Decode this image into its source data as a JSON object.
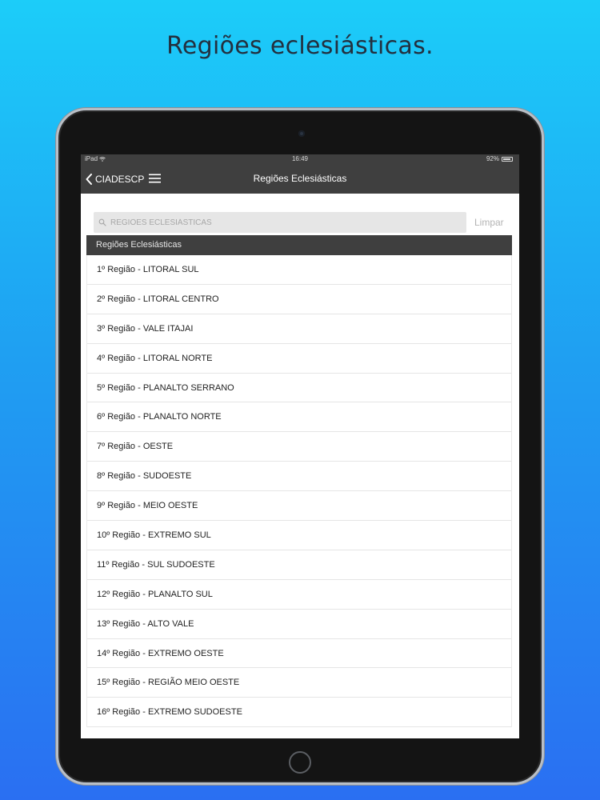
{
  "headline": "Regiões eclesiásticas.",
  "status_bar": {
    "carrier": "iPad",
    "time": "16:49",
    "battery": "92%",
    "battery_level": 0.92
  },
  "nav": {
    "back_label": "CIADESCP",
    "title": "Regiões Eclesiásticas"
  },
  "search": {
    "placeholder": "REGIÕES ECLESIÁSTICAS",
    "value": "",
    "clear_label": "Limpar"
  },
  "section_header": "Regiões Eclesiásticas",
  "regions": [
    "1º Região - LITORAL SUL",
    "2º Região - LITORAL CENTRO",
    "3º Região - VALE ITAJAI",
    "4º Região - LITORAL NORTE",
    "5º Região - PLANALTO SERRANO",
    "6º Região - PLANALTO NORTE",
    "7º Região - OESTE",
    "8º Região - SUDOESTE",
    "9º Região - MEIO OESTE",
    "10º Região - EXTREMO SUL",
    "11º Região - SUL SUDOESTE",
    "12º Região - PLANALTO SUL",
    "13º Região - ALTO VALE",
    "14º Região - EXTREMO OESTE",
    "15º Região - REGIÃO MEIO OESTE",
    "16º Região - EXTREMO SUDOESTE"
  ],
  "colors": {
    "bar_background": "#3f3f3f",
    "gradient_top": "#1ccdf9",
    "gradient_bottom": "#2a6ff2"
  }
}
